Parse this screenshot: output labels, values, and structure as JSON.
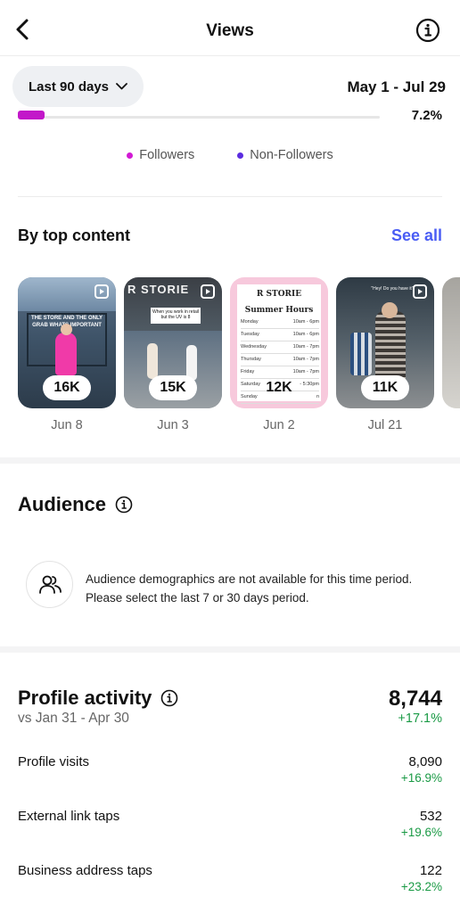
{
  "header": {
    "title": "Views"
  },
  "filter": {
    "range_label": "Last 90 days",
    "date_range": "May 1 - Jul 29"
  },
  "partial_row": {
    "value": "7.2%"
  },
  "legend": [
    {
      "label": "Followers",
      "color": "#d21ad4"
    },
    {
      "label": "Non-Followers",
      "color": "#5b2ce0"
    }
  ],
  "top_content": {
    "title": "By top content",
    "see_all": "See all",
    "items": [
      {
        "views": "16K",
        "date": "Jun 8",
        "caption": "THE STORE AND THE ONLY GRAB WHATS IMPORTANT",
        "store": ""
      },
      {
        "views": "15K",
        "date": "Jun 3",
        "caption": "When you work in retail but the UV is 8",
        "store": "R STORIE"
      },
      {
        "views": "12K",
        "date": "Jun 2",
        "caption": "",
        "store": "R STORIE",
        "hours_title": "Summer Hours",
        "hours": [
          {
            "day": "Monday",
            "time": "10am - 6pm"
          },
          {
            "day": "Tuesday",
            "time": "10am - 6pm"
          },
          {
            "day": "Wednesday",
            "time": "10am - 7pm"
          },
          {
            "day": "Thursday",
            "time": "10am - 7pm"
          },
          {
            "day": "Friday",
            "time": "10am - 7pm"
          },
          {
            "day": "Saturday",
            "time": "- 5:30pm"
          },
          {
            "day": "Sunday",
            "time": "n"
          }
        ]
      },
      {
        "views": "11K",
        "date": "Jul 21",
        "caption": "\"Hey! Do you have it\"",
        "store": ""
      }
    ]
  },
  "audience": {
    "title": "Audience",
    "message": "Audience demographics are not available for this time period. Please select the last 7 or 30 days period."
  },
  "profile_activity": {
    "title": "Profile activity",
    "compare": "vs Jan 31 - Apr 30",
    "total": "8,744",
    "total_change": "+17.1%",
    "metrics": [
      {
        "label": "Profile visits",
        "value": "8,090",
        "change": "+16.9%"
      },
      {
        "label": "External link taps",
        "value": "532",
        "change": "+19.6%"
      },
      {
        "label": "Business address taps",
        "value": "122",
        "change": "+23.2%"
      }
    ]
  }
}
